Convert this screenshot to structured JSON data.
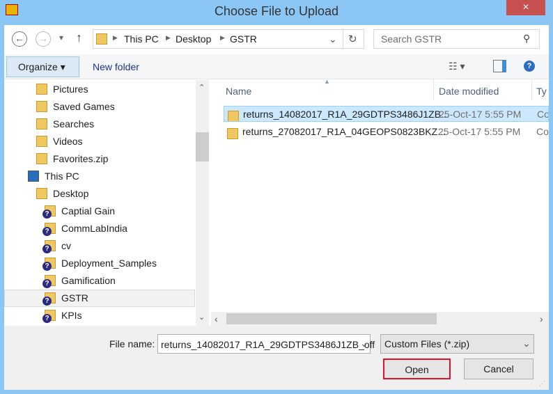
{
  "window": {
    "title": "Choose File to Upload",
    "close": "×"
  },
  "nav": {
    "back": "←",
    "forward": "→",
    "recent": "▾",
    "up": "↑",
    "breadcrumb": [
      "This PC",
      "Desktop",
      "GSTR"
    ],
    "search_placeholder": "Search GSTR"
  },
  "toolbar": {
    "organize": "Organize ▾",
    "new_folder": "New folder"
  },
  "tree": [
    {
      "label": "Pictures",
      "level": 1,
      "icon": "pictures-folder-icon"
    },
    {
      "label": "Saved Games",
      "level": 1,
      "icon": "saved-games-folder-icon"
    },
    {
      "label": "Searches",
      "level": 1,
      "icon": "searches-folder-icon"
    },
    {
      "label": "Videos",
      "level": 1,
      "icon": "videos-folder-icon"
    },
    {
      "label": "Favorites.zip",
      "level": 1,
      "icon": "zip-folder-icon"
    },
    {
      "label": "This PC",
      "level": 0,
      "icon": "computer-icon"
    },
    {
      "label": "Desktop",
      "level": 1,
      "icon": "desktop-folder-icon"
    },
    {
      "label": "Captial Gain",
      "level": 2,
      "icon": "unknown-folder-icon"
    },
    {
      "label": "CommLabIndia",
      "level": 2,
      "icon": "unknown-folder-icon"
    },
    {
      "label": "cv",
      "level": 2,
      "icon": "unknown-folder-icon"
    },
    {
      "label": "Deployment_Samples",
      "level": 2,
      "icon": "unknown-folder-icon"
    },
    {
      "label": "Gamification",
      "level": 2,
      "icon": "unknown-folder-icon"
    },
    {
      "label": "GSTR",
      "level": 2,
      "icon": "unknown-folder-icon",
      "selected": true
    },
    {
      "label": "KPIs",
      "level": 2,
      "icon": "unknown-folder-icon"
    }
  ],
  "columns": {
    "name": "Name",
    "date": "Date modified",
    "type": "Ty"
  },
  "files": [
    {
      "name": "returns_14082017_R1A_29GDTPS3486J1ZB...",
      "date": "25-Oct-17 5:55 PM",
      "type": "Co",
      "selected": true
    },
    {
      "name": "returns_27082017_R1A_04GEOPS0823BKZ...",
      "date": "25-Oct-17 5:55 PM",
      "type": "Co"
    }
  ],
  "footer": {
    "file_name_label": "File name:",
    "file_name_value": "returns_14082017_R1A_29GDTPS3486J1ZB_off",
    "filter": "Custom Files (*.zip)",
    "open": "Open",
    "cancel": "Cancel"
  },
  "colors": {
    "selection": "#cce8ff",
    "highlight_border": "#e81123",
    "frame": "#8bc6f5"
  }
}
